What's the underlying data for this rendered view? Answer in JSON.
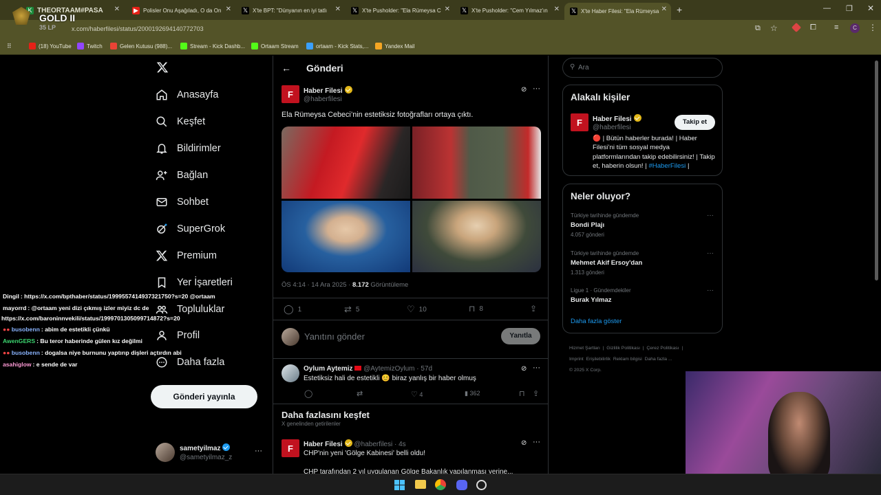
{
  "browser": {
    "tabs": [
      {
        "label": "THEORTAAM#PASA",
        "color": "#1b8a3a"
      },
      {
        "label": "Polisler Onu Aşağıladı, O da On",
        "color": "#e62117"
      },
      {
        "label": "X'te BPT: \"Dünyanın en iyi tatlı",
        "color": "#000"
      },
      {
        "label": "X'te Pusholder: \"Ela Rümeysa C",
        "color": "#000"
      },
      {
        "label": "X'te Pusholder: \"Cem Yılmaz'ın",
        "color": "#000"
      },
      {
        "label": "X'te Haber Filesi: \"Ela Rümeysa",
        "color": "#000"
      }
    ],
    "url": "x.com/haberfilesi/status/2000192694140772703",
    "bookmarks": [
      {
        "label": "(18) YouTube",
        "color": "#e62117"
      },
      {
        "label": "Twitch",
        "color": "#9146ff"
      },
      {
        "label": "Gelen Kutusu (988)...",
        "color": "#ea4335"
      },
      {
        "label": "Stream - Kick Dashb...",
        "color": "#53fc18"
      },
      {
        "label": "Ortaam Stream",
        "color": "#53fc18"
      },
      {
        "label": "ortaam - Kick Stats,...",
        "color": "#3aa0ff"
      },
      {
        "label": "Yandex Mail",
        "color": "#f5a623"
      }
    ]
  },
  "overlay": {
    "rank": "GOLD II",
    "lp": "35 LP"
  },
  "sidebar": {
    "items": [
      {
        "label": "Anasayfa",
        "icon": "home-icon"
      },
      {
        "label": "Keşfet",
        "icon": "search-icon"
      },
      {
        "label": "Bildirimler",
        "icon": "bell-icon"
      },
      {
        "label": "Bağlan",
        "icon": "person-add-icon"
      },
      {
        "label": "Sohbet",
        "icon": "mail-icon"
      },
      {
        "label": "SuperGrok",
        "icon": "grok-icon"
      },
      {
        "label": "Premium",
        "icon": "x-icon"
      },
      {
        "label": "Yer İşaretleri",
        "icon": "bookmark-icon"
      },
      {
        "label": "Topluluklar",
        "icon": "people-icon"
      },
      {
        "label": "Profil",
        "icon": "profile-icon"
      },
      {
        "label": "Daha fazla",
        "icon": "more-circle-icon"
      }
    ],
    "post_button": "Gönderi yayınla",
    "account": {
      "name": "sametyilmaz",
      "handle": "@sametyilmaz_z"
    }
  },
  "main": {
    "header": "Gönderi",
    "post": {
      "name": "Haber Filesi",
      "handle": "@haberfilesi",
      "text": "Ela Rümeysa Cebeci’nin estetiksiz fotoğrafları ortaya çıktı.",
      "time": "ÖS 4:14 · 14 Ara 2025 · ",
      "views": "8.172",
      "views_label": " Görüntüleme",
      "replies": "1",
      "reposts": "5",
      "likes": "10",
      "bookmarks": "8"
    },
    "reply_box": {
      "placeholder": "Yanıtını gönder",
      "button": "Yanıtla"
    },
    "reply": {
      "name": "Oylum Aytemiz",
      "handle": "@AytemizOylum · 57d",
      "text": "Estetiksiz hali de estetikli 😊 biraz yanlış bir haber olmuş",
      "likes": "4",
      "views": "362"
    },
    "discover": {
      "title": "Daha fazlasını keşfet",
      "subtitle": "X genelinden getirilenler"
    },
    "next_post": {
      "name": "Haber Filesi",
      "handle": "@haberfilesi · 4s",
      "text": "CHP'nin yeni 'Gölge Kabinesi' belli oldu!",
      "text2": "CHP tarafından 2 yıl uygulanan Gölge Bakanlık yapılanması yerine..."
    }
  },
  "right": {
    "search_placeholder": "Ara",
    "related": {
      "title": "Alakalı kişiler",
      "name": "Haber Filesi",
      "handle": "@haberfilesi",
      "follow": "Takip et",
      "bio": "🔴 | Bütün haberler burada! | Haber Filesi’ni tüm sosyal medya platformlarından takip edebilirsiniz! | Takip et, haberin olsun! |",
      "hashtag": "#HaberFilesi",
      "bio_end": " |"
    },
    "trends": {
      "title": "Neler oluyor?",
      "items": [
        {
          "context": "Türkiye tarihinde gündemde",
          "name": "Bondi Plajı",
          "count": "4.057 gönderi"
        },
        {
          "context": "Türkiye tarihinde gündemde",
          "name": "Mehmet Akif Ersoy'dan",
          "count": "1.313 gönderi"
        },
        {
          "context": "Ligue 1 · Gündemdekiler",
          "name": "Burak Yılmaz",
          "count": ""
        }
      ],
      "more": "Daha fazla göster"
    },
    "footer": [
      "Hizmet Şartları",
      "|",
      "Gizlilik Politikası",
      "|",
      "Çerez Politikası",
      "|",
      "Imprint",
      "Erişilebilirlik",
      "Reklam bilgisi",
      "Daha fazla ...",
      "© 2025 X Corp."
    ]
  },
  "chat": [
    {
      "user": "Dingil",
      "color": "#ffffff",
      "msg": ": https://x.com/bpthaber/status/1999557414937321750?s=20 @ortaam"
    },
    {
      "user": "mayorrd",
      "color": "#ffffff",
      "msg": ": @ortaam yeni dizi çıkmış izler miyiz dc de"
    },
    {
      "user": "",
      "color": "#ffffff",
      "msg": "https://x.com/baroninnvekili/status/1999701305099714872?s=20"
    },
    {
      "user": "busobenn",
      "color": "#8ab4ff",
      "msg": ": abim de estetikli çünkü"
    },
    {
      "user": "AwenGERS",
      "color": "#3cd670",
      "msg": ": Bu teror haberinde gülen kız değilmi"
    },
    {
      "user": "busobenn",
      "color": "#8ab4ff",
      "msg": ": dogalsa niye burnunu yaptırıp dişleri açtırdın abi"
    },
    {
      "user": "asahiglow",
      "color": "#ff9ad5",
      "msg": ": e sende de var"
    }
  ],
  "colors": {
    "accent": "#1d9bf0",
    "brand": "#c1121f",
    "bg": "#000000",
    "chrome": "#535328"
  }
}
